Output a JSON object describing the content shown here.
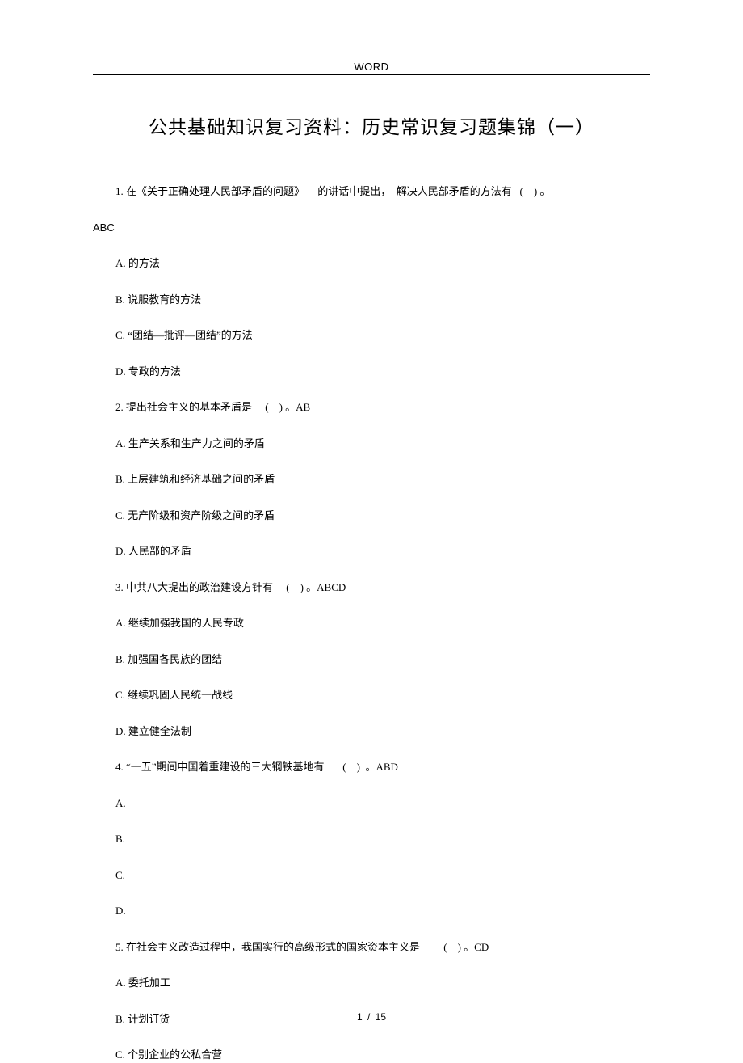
{
  "header": {
    "label": "WORD"
  },
  "title": "公共基础知识复习资料：历史常识复习题集锦（一）",
  "questions": [
    {
      "stem": "1. 在《关于正确处理人民部矛盾的问题》     的讲话中提出，  解决人民部矛盾的方法有   (    ) 。",
      "answer_inline": "ABC",
      "answer_newline": true,
      "options": [
        "A. 的方法",
        "B. 说服教育的方法",
        "C. “团结—批评—团结”的方法",
        "D. 专政的方法"
      ]
    },
    {
      "stem": "2. 提出社会主义的基本矛盾是     (    ) 。AB",
      "answer_inline": "",
      "answer_newline": false,
      "options": [
        "A. 生产关系和生产力之间的矛盾",
        "B. 上层建筑和经济基础之间的矛盾",
        "C. 无产阶级和资产阶级之间的矛盾",
        "D. 人民部的矛盾"
      ]
    },
    {
      "stem": "3. 中共八大提出的政治建设方针有     (    ) 。ABCD",
      "answer_inline": "",
      "answer_newline": false,
      "options": [
        "A. 继续加强我国的人民专政",
        "B. 加强国各民族的团结",
        "C. 继续巩固人民统一战线",
        "D. 建立健全法制"
      ]
    },
    {
      "stem": "4. “一五”期间中国着重建设的三大钢铁基地有       (    )  。ABD",
      "answer_inline": "",
      "answer_newline": false,
      "options": [
        "A.",
        "B.",
        "C.",
        "D."
      ]
    },
    {
      "stem": "5. 在社会主义改造过程中，我国实行的高级形式的国家资本主义是         (    ) 。CD",
      "answer_inline": "",
      "answer_newline": false,
      "options": [
        "A. 委托加工",
        "B. 计划订货",
        "C. 个别企业的公私合营"
      ]
    }
  ],
  "footer": {
    "page": "1",
    "sep": "/",
    "total": "15"
  }
}
